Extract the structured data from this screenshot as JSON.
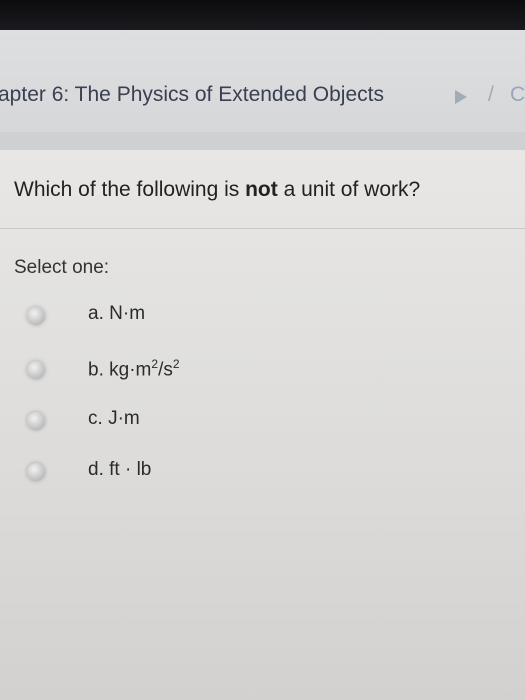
{
  "breadcrumb": {
    "title": "apter 6: The Physics of Extended Objects",
    "separator": "/",
    "next": "C"
  },
  "question": {
    "prefix": "Which of the following is ",
    "emphasis": "not",
    "suffix": " a unit of work?"
  },
  "select_label": "Select one:",
  "options": [
    {
      "letter": "a.",
      "text": "N·m"
    },
    {
      "letter": "b.",
      "text": "kg·m",
      "sup1": "2",
      "mid": "/s",
      "sup2": "2"
    },
    {
      "letter": "c.",
      "text": "J·m"
    },
    {
      "letter": "d.",
      "text": "ft · lb"
    }
  ]
}
